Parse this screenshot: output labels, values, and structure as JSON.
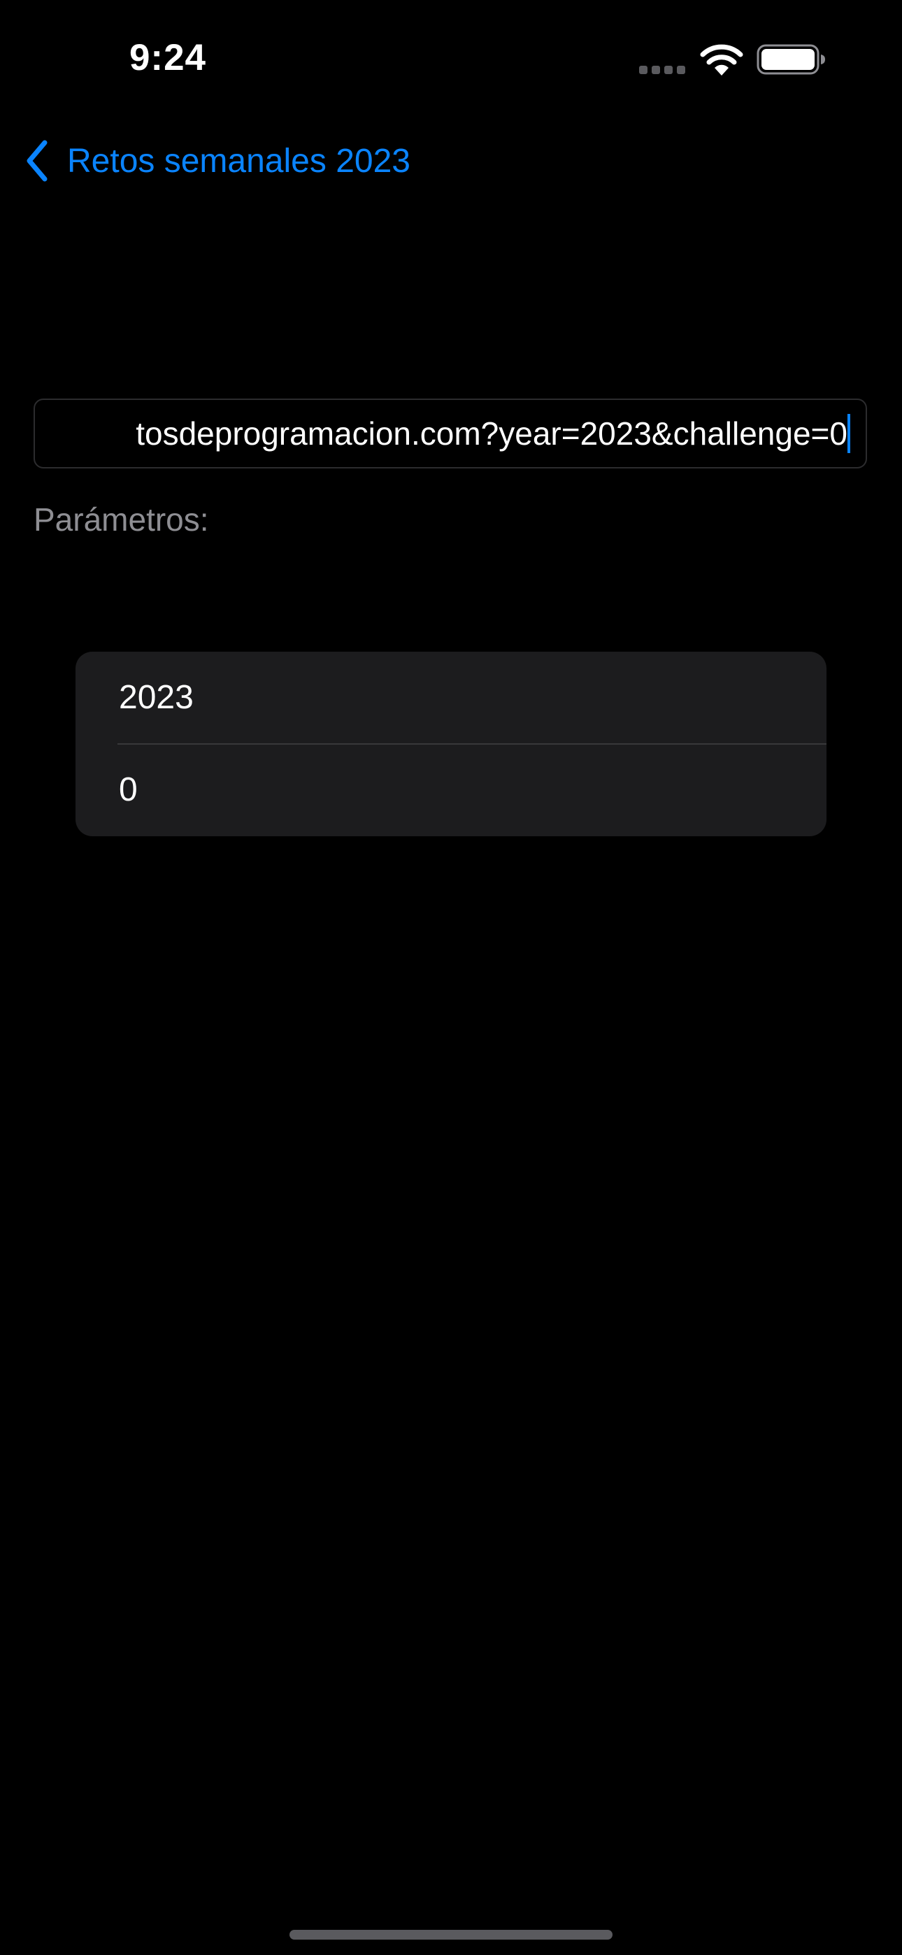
{
  "status_bar": {
    "time": "9:24",
    "icons": [
      "cellular-icon",
      "wifi-icon",
      "battery-icon"
    ]
  },
  "nav": {
    "back_label": "Retos semanales 2023",
    "back_icon": "chevron-left-icon"
  },
  "url_field": {
    "value": "tosdeprogramacion.com?year=2023&challenge=0"
  },
  "params": {
    "label": "Parámetros:",
    "items": [
      {
        "value": "2023"
      },
      {
        "value": "0"
      }
    ]
  },
  "colors": {
    "background": "#000000",
    "accent": "#0a84ff",
    "secondary_text": "#8e8e93",
    "list_background": "#1c1c1e"
  }
}
